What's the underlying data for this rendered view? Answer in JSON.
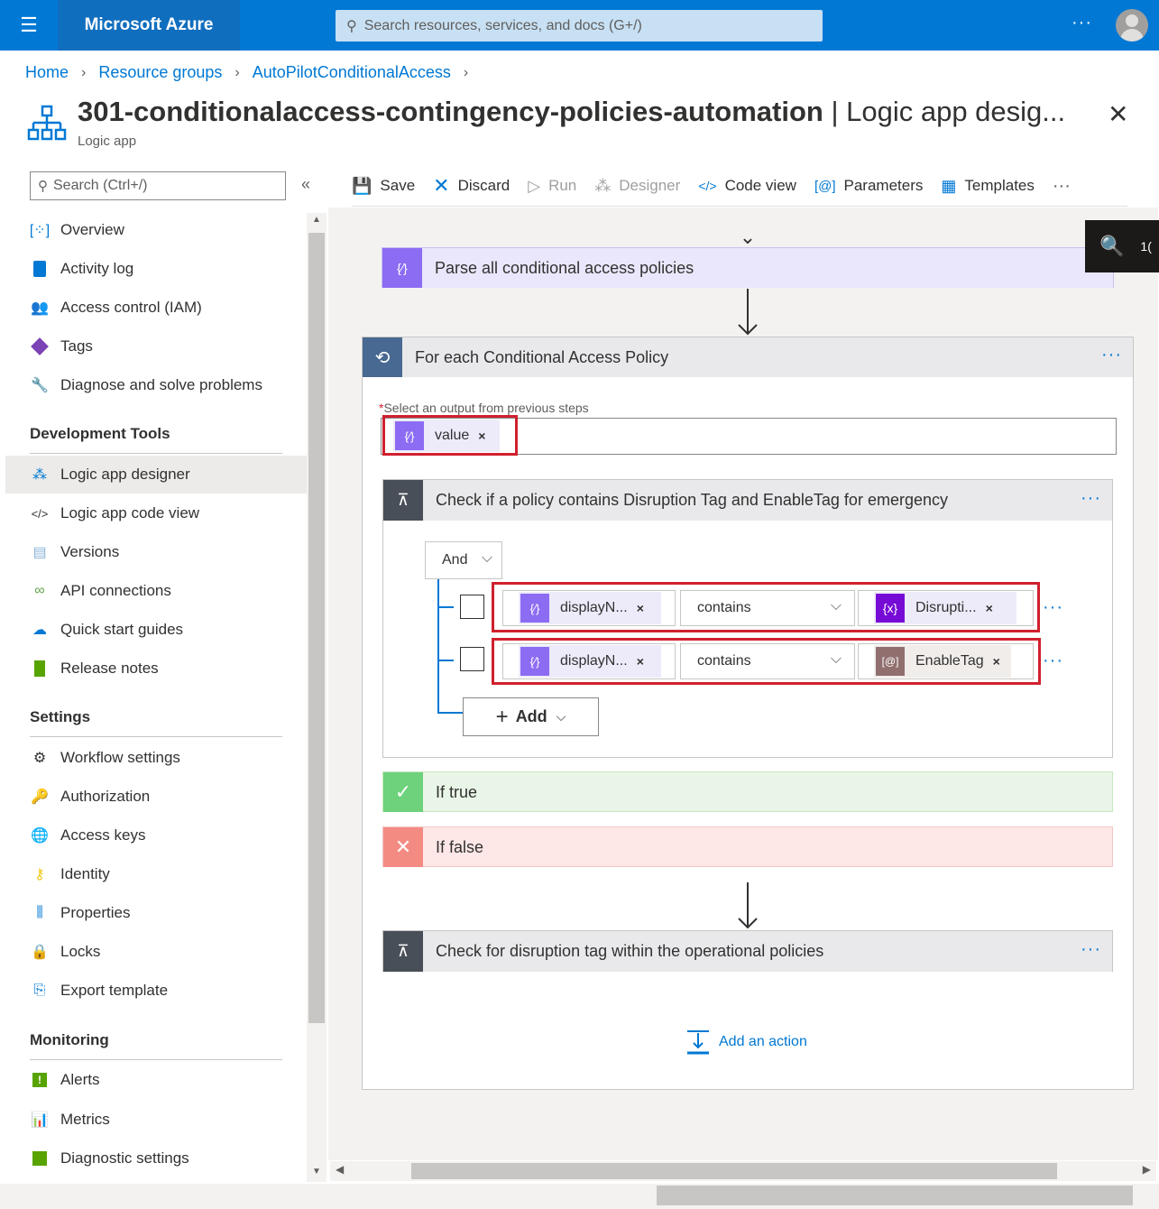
{
  "topbar": {
    "brand": "Microsoft Azure",
    "search_placeholder": "Search resources, services, and docs (G+/)",
    "more": "···"
  },
  "breadcrumb": [
    "Home",
    "Resource groups",
    "AutoPilotConditionalAccess"
  ],
  "page": {
    "title_main": "301-conditionalaccess-contingency-policies-automation",
    "title_suffix": " | Logic app desig...",
    "subtitle": "Logic app",
    "close": "✕"
  },
  "sidebar": {
    "search_placeholder": "Search (Ctrl+/)",
    "collapse": "«",
    "items": [
      {
        "label": "Overview",
        "icon": "overview-icon"
      },
      {
        "label": "Activity log",
        "icon": "activity-log-icon"
      },
      {
        "label": "Access control (IAM)",
        "icon": "iam-icon"
      },
      {
        "label": "Tags",
        "icon": "tag-icon"
      },
      {
        "label": "Diagnose and solve problems",
        "icon": "wrench-icon"
      }
    ],
    "dev_header": "Development Tools",
    "dev_items": [
      {
        "label": "Logic app designer",
        "icon": "designer-icon",
        "active": true
      },
      {
        "label": "Logic app code view",
        "icon": "code-icon"
      },
      {
        "label": "Versions",
        "icon": "versions-icon"
      },
      {
        "label": "API connections",
        "icon": "link-icon"
      },
      {
        "label": "Quick start guides",
        "icon": "cloud-icon"
      },
      {
        "label": "Release notes",
        "icon": "bookmark-icon"
      }
    ],
    "settings_header": "Settings",
    "settings_items": [
      {
        "label": "Workflow settings",
        "icon": "gear-icon"
      },
      {
        "label": "Authorization",
        "icon": "key-icon"
      },
      {
        "label": "Access keys",
        "icon": "globe-icon"
      },
      {
        "label": "Identity",
        "icon": "identity-icon"
      },
      {
        "label": "Properties",
        "icon": "properties-icon"
      },
      {
        "label": "Locks",
        "icon": "lock-icon"
      },
      {
        "label": "Export template",
        "icon": "export-icon"
      }
    ],
    "monitoring_header": "Monitoring",
    "monitoring_items": [
      {
        "label": "Alerts",
        "icon": "alert-icon"
      },
      {
        "label": "Metrics",
        "icon": "metrics-icon"
      },
      {
        "label": "Diagnostic settings",
        "icon": "diagnostic-icon"
      }
    ]
  },
  "toolbar": {
    "save": "Save",
    "discard": "Discard",
    "run": "Run",
    "designer": "Designer",
    "code_view": "Code view",
    "parameters": "Parameters",
    "templates": "Templates",
    "more": "···"
  },
  "designer": {
    "zoom_label": "1(",
    "parse_step": "Parse all conditional access policies",
    "foreach_step": "For each Conditional Access Policy",
    "foreach_prompt": "Select an output from previous steps",
    "foreach_required": "*",
    "foreach_token": "value",
    "condition_step": "Check if a policy contains Disruption Tag and EnableTag for emergency",
    "and_label": "And",
    "rows": [
      {
        "left": "displayN...",
        "operator": "contains",
        "right": "Disrupti..."
      },
      {
        "left": "displayN...",
        "operator": "contains",
        "right": "EnableTag"
      }
    ],
    "add_label": "Add",
    "if_true": "If true",
    "if_false": "If false",
    "check_step": "Check for disruption tag within the operational policies",
    "add_action": "Add an action",
    "dots": "···",
    "token_close": "×"
  }
}
